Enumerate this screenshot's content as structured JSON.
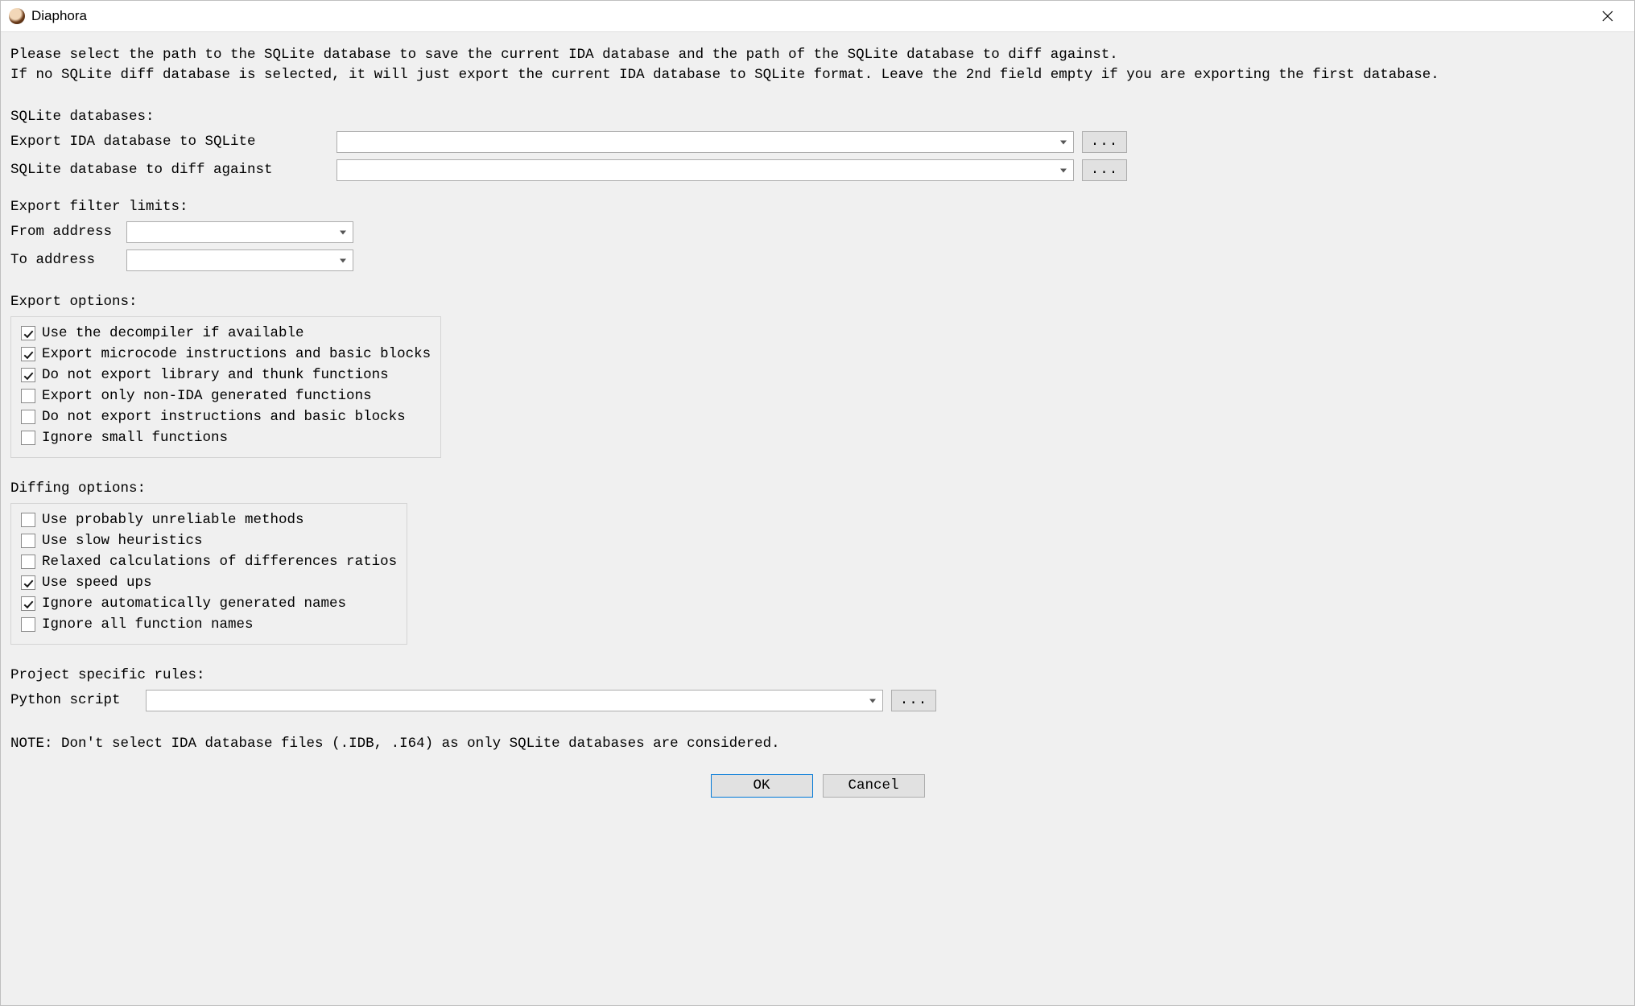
{
  "window": {
    "title": "Diaphora"
  },
  "intro": {
    "line1": "Please select the path to the SQLite database to save the current IDA database and the path of the SQLite database to diff against.",
    "line2": "If no SQLite diff database is selected, it will just export the current IDA database to SQLite format. Leave the 2nd field empty if you are exporting the first database."
  },
  "sqlite": {
    "section": "SQLite databases:",
    "export_label": "Export IDA database to SQLite",
    "export_value": "",
    "diff_label": "SQLite database to diff against",
    "diff_value": "",
    "browse": "..."
  },
  "filter": {
    "section": "Export filter limits:",
    "from_label": "From address",
    "from_value": "",
    "to_label": "To address",
    "to_value": ""
  },
  "export_options": {
    "section": "Export options:",
    "items": [
      {
        "label": "Use the decompiler if available",
        "checked": true
      },
      {
        "label": "Export microcode instructions and basic blocks",
        "checked": true
      },
      {
        "label": "Do not export library and thunk functions",
        "checked": true
      },
      {
        "label": "Export only non-IDA generated functions",
        "checked": false
      },
      {
        "label": "Do not export instructions and basic blocks",
        "checked": false
      },
      {
        "label": "Ignore small functions",
        "checked": false
      }
    ]
  },
  "diffing_options": {
    "section": "Diffing options:",
    "items": [
      {
        "label": "Use probably unreliable methods",
        "checked": false
      },
      {
        "label": "Use slow heuristics",
        "checked": false
      },
      {
        "label": "Relaxed calculations of differences ratios",
        "checked": false
      },
      {
        "label": "Use speed ups",
        "checked": true
      },
      {
        "label": "Ignore automatically generated names",
        "checked": true
      },
      {
        "label": "Ignore all function names",
        "checked": false
      }
    ]
  },
  "project": {
    "section": "Project specific rules:",
    "script_label": "Python script",
    "script_value": "",
    "browse": "..."
  },
  "note": "NOTE: Don't select IDA database files (.IDB, .I64) as only SQLite databases are considered.",
  "buttons": {
    "ok": "OK",
    "cancel": "Cancel"
  }
}
